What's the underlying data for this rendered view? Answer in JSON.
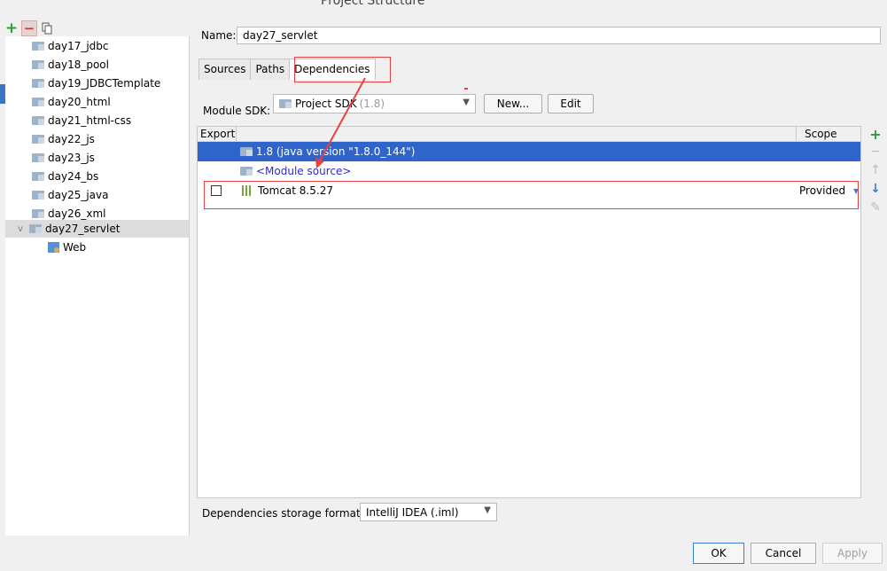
{
  "window": {
    "title": "Project Structure"
  },
  "left_toolbar": {
    "add": "+",
    "remove": "−"
  },
  "modules": [
    {
      "label": "day17_jdbc"
    },
    {
      "label": "day18_pool"
    },
    {
      "label": "day19_JDBCTemplate"
    },
    {
      "label": "day20_html"
    },
    {
      "label": "day21_html-css"
    },
    {
      "label": "day22_js"
    },
    {
      "label": "day23_js"
    },
    {
      "label": "day24_bs"
    },
    {
      "label": "day25_java"
    },
    {
      "label": "day26_xml"
    },
    {
      "label": "day27_servlet",
      "selected": true,
      "expanded": true
    }
  ],
  "facet": {
    "label": "Web"
  },
  "name_field": {
    "label": "Name:",
    "value": "day27_servlet"
  },
  "tabs": [
    {
      "label": "Sources"
    },
    {
      "label": "Paths"
    },
    {
      "label": "Dependencies",
      "active": true
    }
  ],
  "sdk": {
    "label": "Module SDK:",
    "value": "Project SDK",
    "version": "(1.8)",
    "new_button": "New...",
    "edit_button": "Edit"
  },
  "dependencies": {
    "header_export": "Export",
    "header_scope": "Scope",
    "rows": [
      {
        "name": "1.8 (java version \"1.8.0_144\")",
        "selected": true
      },
      {
        "name": "<Module source>"
      },
      {
        "name": "Tomcat 8.5.27",
        "scope": "Provided",
        "export": false
      }
    ]
  },
  "side_tools": {
    "add": "+",
    "remove": "−",
    "up": "↑",
    "down": "↓",
    "edit": "✎"
  },
  "storage": {
    "label": "Dependencies storage format:",
    "value": "IntelliJ IDEA (.iml)"
  },
  "footer": {
    "ok": "OK",
    "cancel": "Cancel",
    "apply": "Apply"
  },
  "colors": {
    "selection": "#2f65ca",
    "annotation": "#e74141",
    "link": "#2a2ad0"
  }
}
